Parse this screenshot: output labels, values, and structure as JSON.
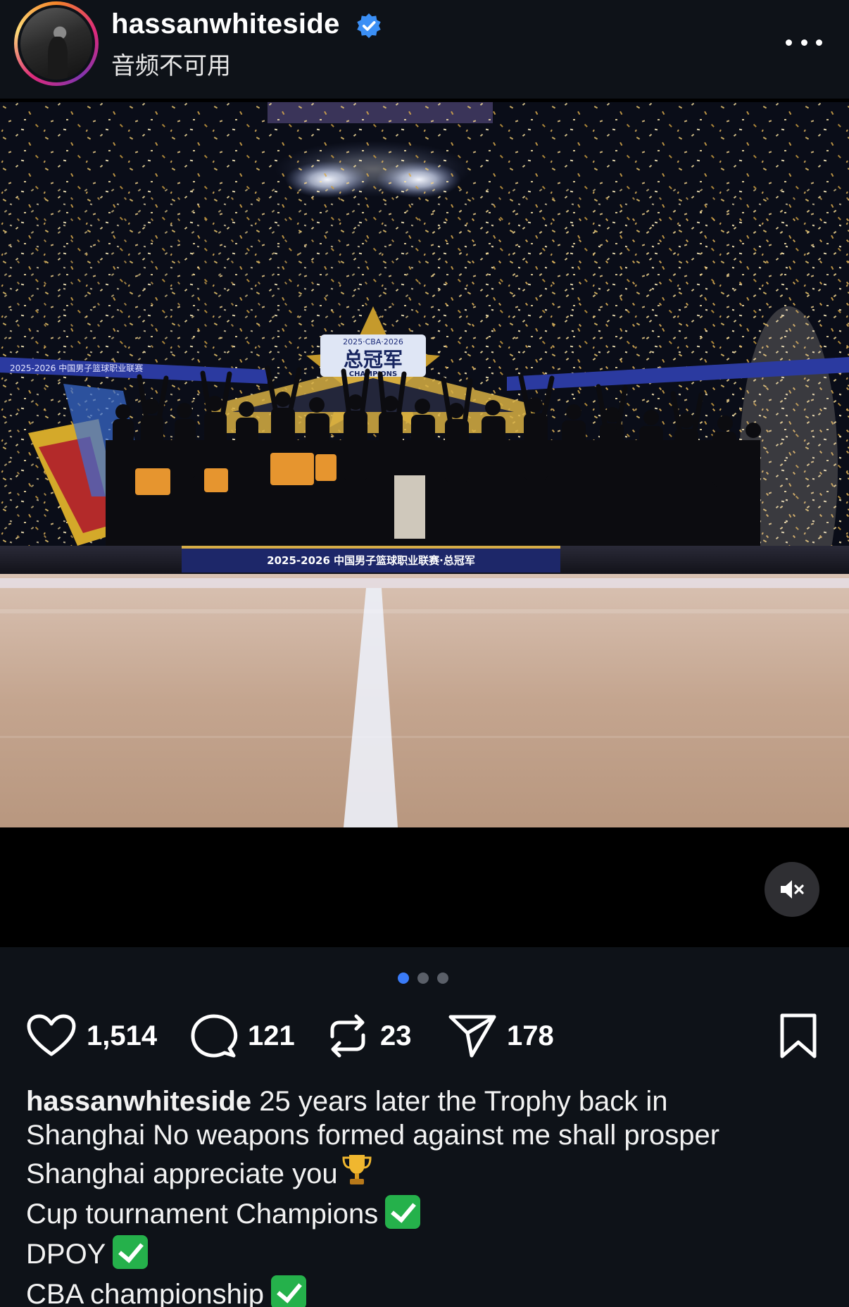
{
  "header": {
    "username": "hassanwhiteside",
    "subtitle": "音频不可用",
    "verified": true,
    "more_icon": "more-horizontal-icon"
  },
  "photo": {
    "banner_text": "2025-2026 中国男子篮球职业联赛·总冠军",
    "logo_title": "总冠军",
    "logo_league": "2025·CBA·2026",
    "logo_sub": "CHAMPIONS",
    "left_banner": "2025-2026 中国男子篮球职业联赛"
  },
  "media": {
    "mute_icon": "speaker-muted-icon",
    "carousel_count": 3,
    "carousel_active": 0
  },
  "actions": {
    "likes": "1,514",
    "comments": "121",
    "reposts": "23",
    "shares": "178",
    "like_icon": "heart-icon",
    "comment_icon": "comment-bubble-icon",
    "repost_icon": "repost-icon",
    "share_icon": "paper-plane-icon",
    "bookmark_icon": "bookmark-icon"
  },
  "caption": {
    "username": "hassanwhiteside",
    "line1": " 25 years later the Trophy back in",
    "line2": "Shanghai No weapons formed against me shall prosper",
    "line3": "Shanghai appreciate you",
    "line4": "Cup tournament  Champions",
    "line5": "DPOY",
    "line6": "CBA championship"
  },
  "colors": {
    "background": "#0e1218",
    "accent_blue": "#3a7bf7",
    "check_green": "#25b14b"
  }
}
